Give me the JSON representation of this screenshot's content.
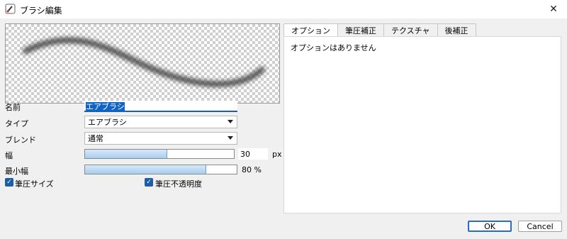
{
  "window": {
    "title": "ブラシ編集",
    "close_glyph": "✕"
  },
  "form": {
    "name_label": "名前",
    "name_value": "エアブラシ",
    "type_label": "タイプ",
    "type_value": "エアブラシ",
    "blend_label": "ブレンド",
    "blend_value": "通常",
    "width_label": "幅",
    "width_value": "30",
    "width_unit": "px",
    "width_level": 0.55,
    "min_width_label": "最小幅",
    "min_width_value": "80 %",
    "min_width_level": 0.8,
    "pressure_size_label": "筆圧サイズ",
    "pressure_size_checked": true,
    "pressure_opacity_label": "筆圧不透明度",
    "pressure_opacity_checked": true
  },
  "tabs": [
    {
      "label": "オプション",
      "active": true
    },
    {
      "label": "筆圧補正",
      "active": false
    },
    {
      "label": "テクスチャ",
      "active": false
    },
    {
      "label": "後補正",
      "active": false
    }
  ],
  "tab_panel": {
    "message": "オプションはありません"
  },
  "buttons": {
    "ok": "OK",
    "cancel": "Cancel"
  },
  "colors": {
    "accent": "#1a5fa8",
    "slider_fill": "#a9cdef"
  },
  "icons": {
    "check": "✓",
    "app": "brush-app-icon"
  }
}
